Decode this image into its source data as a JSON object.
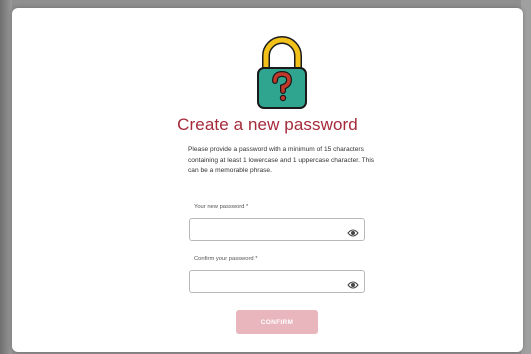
{
  "dialog": {
    "title": "Create a new password",
    "instructions": "Please provide a password with a minimum of 15 characters containing at least 1 lowercase and 1 uppercase character. This can be a memorable phrase."
  },
  "fields": {
    "new_password": {
      "label": "Your new password *",
      "value": "",
      "icon": "eye-icon"
    },
    "confirm_password": {
      "label": "Confirm your password *",
      "value": "",
      "icon": "eye-icon"
    }
  },
  "actions": {
    "confirm_label": "CONFIRM"
  },
  "colors": {
    "title": "#a52a3a",
    "lock_body": "#2fa58f",
    "lock_shackle": "#f2c21b",
    "question_mark": "#c0392b",
    "confirm_button": "#e9b6bd"
  },
  "icons": {
    "header": "lock-question-icon"
  }
}
